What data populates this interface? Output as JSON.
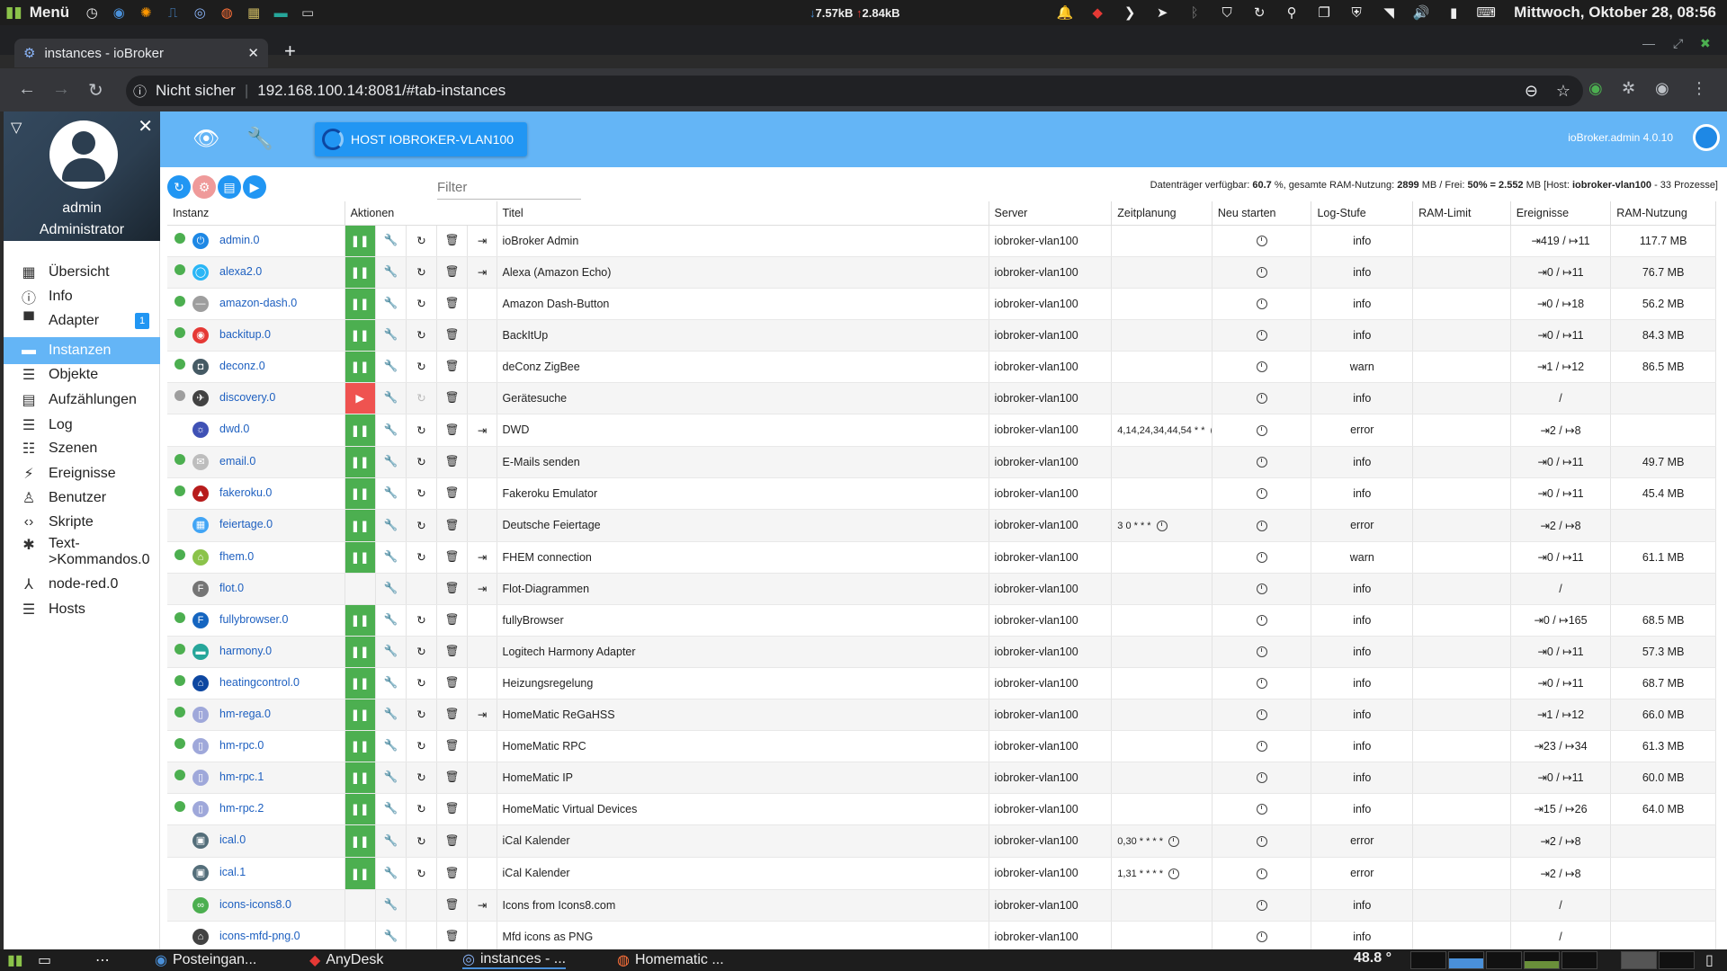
{
  "os_topbar": {
    "menu_label": "Menü",
    "net_down": "7.57kB",
    "net_up": "2.84kB",
    "clock": "Mittwoch, Oktober 28, 08:56"
  },
  "browser": {
    "tab_title": "instances - ioBroker",
    "security_label": "Nicht sicher",
    "url": "192.168.100.14:8081/#tab-instances"
  },
  "sidebar": {
    "user_name": "admin",
    "user_role": "Administrator",
    "items": [
      {
        "label": "Übersicht",
        "icon": "grid-icon"
      },
      {
        "label": "Info",
        "icon": "info-icon"
      },
      {
        "label": "Adapter",
        "icon": "store-icon",
        "badge": "1"
      },
      {
        "label": "Instanzen",
        "icon": "instances-icon",
        "active": true
      },
      {
        "label": "Objekte",
        "icon": "list-icon"
      },
      {
        "label": "Aufzählungen",
        "icon": "enum-icon"
      },
      {
        "label": "Log",
        "icon": "log-icon"
      },
      {
        "label": "Szenen",
        "icon": "scenes-icon"
      },
      {
        "label": "Ereignisse",
        "icon": "events-icon"
      },
      {
        "label": "Benutzer",
        "icon": "user-icon"
      },
      {
        "label": "Skripte",
        "icon": "code-icon"
      },
      {
        "label": "Text->Kommandos.0",
        "icon": "text-commands-icon"
      },
      {
        "label": "node-red.0",
        "icon": "node-red-icon"
      },
      {
        "label": "Hosts",
        "icon": "hosts-icon"
      }
    ]
  },
  "header": {
    "host_button": "HOST IOBROKER-VLAN100",
    "version": "ioBroker.admin 4.0.10"
  },
  "toolbar": {
    "filter_placeholder": "Filter",
    "disk_prefix": "Datenträger verfügbar: ",
    "disk_free": "60.7",
    "ram_text": " %, gesamte RAM-Nutzung: ",
    "ram_used": "2899",
    "free_text": " MB / Frei: ",
    "free_pct": "50% = 2.552",
    "host_text": " MB [Host: ",
    "host_name": "iobroker-vlan100",
    "procs": " - 33 Prozesse]"
  },
  "table": {
    "headers": [
      "Instanz",
      "Aktionen",
      "Titel",
      "Server",
      "Zeitplanung",
      "Neu starten",
      "Log-Stufe",
      "RAM-Limit",
      "Ereignisse",
      "RAM-Nutzung"
    ],
    "rows": [
      {
        "status": "green",
        "name": "admin.0",
        "color": "#1e88e5",
        "glyph": "⏻",
        "running": true,
        "restart": true,
        "link": true,
        "title": "ioBroker Admin",
        "server": "iobroker-vlan100",
        "schedule": "",
        "log": "info",
        "events": "⇥419 / ↦11",
        "ram": "117.7 MB"
      },
      {
        "status": "green",
        "name": "alexa2.0",
        "color": "#29b6f6",
        "glyph": "◯",
        "running": true,
        "restart": true,
        "link": true,
        "title": "Alexa (Amazon Echo)",
        "server": "iobroker-vlan100",
        "schedule": "",
        "log": "info",
        "events": "⇥0 / ↦11",
        "ram": "76.7 MB"
      },
      {
        "status": "green",
        "name": "amazon-dash.0",
        "color": "#9e9e9e",
        "glyph": "—",
        "running": true,
        "restart": true,
        "link": false,
        "title": "Amazon Dash-Button",
        "server": "iobroker-vlan100",
        "schedule": "",
        "log": "info",
        "events": "⇥0 / ↦18",
        "ram": "56.2 MB"
      },
      {
        "status": "green",
        "name": "backitup.0",
        "color": "#e53935",
        "glyph": "◉",
        "running": true,
        "restart": true,
        "link": false,
        "title": "BackItUp",
        "server": "iobroker-vlan100",
        "schedule": "",
        "log": "info",
        "events": "⇥0 / ↦11",
        "ram": "84.3 MB"
      },
      {
        "status": "green",
        "name": "deconz.0",
        "color": "#455a64",
        "glyph": "◘",
        "running": true,
        "restart": true,
        "link": false,
        "title": "deConz ZigBee",
        "server": "iobroker-vlan100",
        "schedule": "",
        "log": "warn",
        "events": "⇥1 / ↦12",
        "ram": "86.5 MB"
      },
      {
        "status": "grey",
        "name": "discovery.0",
        "color": "#424242",
        "glyph": "✈",
        "running": false,
        "restart": true,
        "link": false,
        "title": "Gerätesuche",
        "server": "iobroker-vlan100",
        "schedule": "",
        "log": "info",
        "events": "/",
        "ram": ""
      },
      {
        "status": "none",
        "name": "dwd.0",
        "color": "#3f51b5",
        "glyph": "☼",
        "running": true,
        "restart": true,
        "link": true,
        "title": "DWD",
        "server": "iobroker-vlan100",
        "schedule": "4,14,24,34,44,54 * *",
        "log": "error",
        "events": "⇥2 / ↦8",
        "ram": ""
      },
      {
        "status": "green",
        "name": "email.0",
        "color": "#bdbdbd",
        "glyph": "✉",
        "running": true,
        "restart": true,
        "link": false,
        "title": "E-Mails senden",
        "server": "iobroker-vlan100",
        "schedule": "",
        "log": "info",
        "events": "⇥0 / ↦11",
        "ram": "49.7 MB"
      },
      {
        "status": "green",
        "name": "fakeroku.0",
        "color": "#b71c1c",
        "glyph": "▲",
        "running": true,
        "restart": true,
        "link": false,
        "title": "Fakeroku Emulator",
        "server": "iobroker-vlan100",
        "schedule": "",
        "log": "info",
        "events": "⇥0 / ↦11",
        "ram": "45.4 MB"
      },
      {
        "status": "none",
        "name": "feiertage.0",
        "color": "#42a5f5",
        "glyph": "▦",
        "running": true,
        "restart": true,
        "link": false,
        "title": "Deutsche Feiertage",
        "server": "iobroker-vlan100",
        "schedule": "3 0 * * *",
        "log": "error",
        "events": "⇥2 / ↦8",
        "ram": ""
      },
      {
        "status": "green",
        "name": "fhem.0",
        "color": "#8bc34a",
        "glyph": "⌂",
        "running": true,
        "restart": true,
        "link": true,
        "title": "FHEM connection",
        "server": "iobroker-vlan100",
        "schedule": "",
        "log": "warn",
        "events": "⇥0 / ↦11",
        "ram": "61.1 MB"
      },
      {
        "status": "none",
        "name": "flot.0",
        "color": "#757575",
        "glyph": "F",
        "running": null,
        "restart": false,
        "link": true,
        "title": "Flot-Diagrammen",
        "server": "iobroker-vlan100",
        "schedule": "",
        "log": "info",
        "events": "/",
        "ram": ""
      },
      {
        "status": "green",
        "name": "fullybrowser.0",
        "color": "#1565c0",
        "glyph": "F",
        "running": true,
        "restart": true,
        "link": false,
        "title": "fullyBrowser",
        "server": "iobroker-vlan100",
        "schedule": "",
        "log": "info",
        "events": "⇥0 / ↦165",
        "ram": "68.5 MB"
      },
      {
        "status": "green",
        "name": "harmony.0",
        "color": "#26a69a",
        "glyph": "▬",
        "running": true,
        "restart": true,
        "link": false,
        "title": "Logitech Harmony Adapter",
        "server": "iobroker-vlan100",
        "schedule": "",
        "log": "info",
        "events": "⇥0 / ↦11",
        "ram": "57.3 MB"
      },
      {
        "status": "green",
        "name": "heatingcontrol.0",
        "color": "#0d47a1",
        "glyph": "⌂",
        "running": true,
        "restart": true,
        "link": false,
        "title": "Heizungsregelung",
        "server": "iobroker-vlan100",
        "schedule": "",
        "log": "info",
        "events": "⇥0 / ↦11",
        "ram": "68.7 MB"
      },
      {
        "status": "green",
        "name": "hm-rega.0",
        "color": "#9fa8da",
        "glyph": "▯",
        "running": true,
        "restart": true,
        "link": true,
        "title": "HomeMatic ReGaHSS",
        "server": "iobroker-vlan100",
        "schedule": "",
        "log": "info",
        "events": "⇥1 / ↦12",
        "ram": "66.0 MB"
      },
      {
        "status": "green",
        "name": "hm-rpc.0",
        "color": "#9fa8da",
        "glyph": "▯",
        "running": true,
        "restart": true,
        "link": false,
        "title": "HomeMatic RPC",
        "server": "iobroker-vlan100",
        "schedule": "",
        "log": "info",
        "events": "⇥23 / ↦34",
        "ram": "61.3 MB"
      },
      {
        "status": "green",
        "name": "hm-rpc.1",
        "color": "#9fa8da",
        "glyph": "▯",
        "running": true,
        "restart": true,
        "link": false,
        "title": "HomeMatic IP",
        "server": "iobroker-vlan100",
        "schedule": "",
        "log": "info",
        "events": "⇥0 / ↦11",
        "ram": "60.0 MB"
      },
      {
        "status": "green",
        "name": "hm-rpc.2",
        "color": "#9fa8da",
        "glyph": "▯",
        "running": true,
        "restart": true,
        "link": false,
        "title": "HomeMatic Virtual Devices",
        "server": "iobroker-vlan100",
        "schedule": "",
        "log": "info",
        "events": "⇥15 / ↦26",
        "ram": "64.0 MB"
      },
      {
        "status": "none",
        "name": "ical.0",
        "color": "#546e7a",
        "glyph": "▣",
        "running": true,
        "restart": true,
        "link": false,
        "title": "iCal Kalender",
        "server": "iobroker-vlan100",
        "schedule": "0,30 * * * *",
        "log": "error",
        "events": "⇥2 / ↦8",
        "ram": ""
      },
      {
        "status": "none",
        "name": "ical.1",
        "color": "#546e7a",
        "glyph": "▣",
        "running": true,
        "restart": true,
        "link": false,
        "title": "iCal Kalender",
        "server": "iobroker-vlan100",
        "schedule": "1,31 * * * *",
        "log": "error",
        "events": "⇥2 / ↦8",
        "ram": ""
      },
      {
        "status": "none",
        "name": "icons-icons8.0",
        "color": "#4caf50",
        "glyph": "∞",
        "running": null,
        "restart": false,
        "link": true,
        "title": "Icons from Icons8.com",
        "server": "iobroker-vlan100",
        "schedule": "",
        "log": "info",
        "events": "/",
        "ram": ""
      },
      {
        "status": "none",
        "name": "icons-mfd-png.0",
        "color": "#424242",
        "glyph": "⌂",
        "running": null,
        "restart": false,
        "link": false,
        "title": "Mfd icons as PNG",
        "server": "iobroker-vlan100",
        "schedule": "",
        "log": "info",
        "events": "/",
        "ram": ""
      }
    ]
  },
  "taskbar": {
    "items": [
      "Posteingan...",
      "AnyDesk",
      "instances - ...",
      "Homematic ..."
    ],
    "temperature": "48.8 °"
  }
}
